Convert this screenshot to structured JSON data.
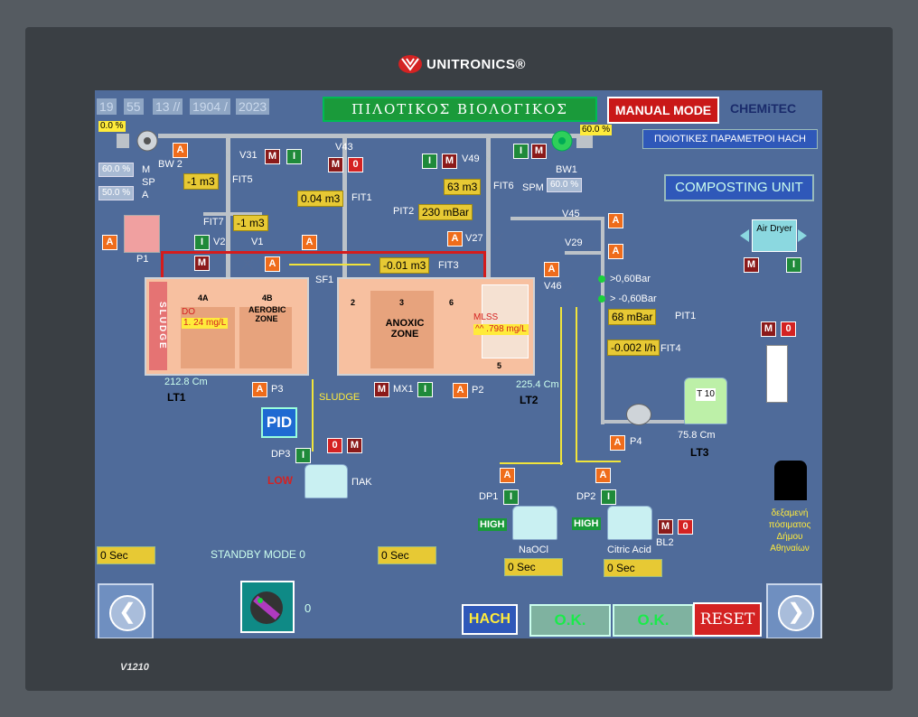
{
  "brand": {
    "name": "UNITRONICS®",
    "model": "V1210"
  },
  "clock": {
    "hour": "19",
    "minute": "55",
    "day": "13 //",
    "year_code": "1904 /",
    "year": "2023"
  },
  "title": "ΠΙΛΟΤΙΚΟΣ  ΒΙΟΛΟΓΙΚΟΣ",
  "mode_label": "MANUAL MODE",
  "chemitec_logo": "CHEMiTEC",
  "hach_params_label": "ΠΟΙΟΤΙΚΕΣ ΠΑΡΑΜΕΤΡΟΙ HACH",
  "composting_label": "COMPOSTING UNIT",
  "bw2": {
    "label": "BW 2",
    "percent": "0.0 %",
    "m_val": "60.0 %",
    "sp_val": "50.0 %",
    "m_lbl": "M",
    "sp_lbl": "SP",
    "a_lbl": "A"
  },
  "bw1": {
    "label": "BW1",
    "percent": "60.0 %",
    "spm_label": "SPM",
    "spm_val": "60.0 %"
  },
  "valves": {
    "v31": "V31",
    "v43": "V43",
    "v49": "V49",
    "v45": "V45",
    "v29": "V29",
    "v46": "V46",
    "v27": "V27",
    "v2": "V2",
    "v1": "V1"
  },
  "flows": {
    "fit5_val": "-1 m3",
    "fit5": "FIT5",
    "fit1_val": "0.04 m3",
    "fit1": "FIT1",
    "fit6_val": "63 m3",
    "fit6": "FIT6",
    "fit7": "FIT7",
    "fit7_val": "-1 m3",
    "pit2": "PIT2",
    "pit2_val": "230 mBar",
    "fit3_val": "-0.01 m3",
    "fit3": "FIT3",
    "pit1_val": "68 mBar",
    "pit1": "PIT1",
    "fit4_val": "-0.002 l/h",
    "fit4": "FIT4"
  },
  "pressure_switches": {
    "high": ">0,60Bar",
    "low": "> -0,60Bar"
  },
  "tanks": {
    "sludge": "SLUDGE",
    "t4a": "4A",
    "t4b": "4B",
    "aerobic": "AEROBIC ZONE",
    "t2": "2",
    "t3": "3",
    "anoxic": "ANOXIC ZONE",
    "t6": "6",
    "t5": "5",
    "do_label": "DO",
    "do_val": "1.  24 mg/L",
    "mlss_label": "MLSS",
    "mlss_val": "^^ .798 mg/L",
    "lt1_level": "212.8 Cm",
    "lt1": "LT1",
    "lt2_level": "225.4 Cm",
    "lt2": "LT2",
    "lt3_level": "75.8 Cm",
    "lt3": "LT3",
    "t10": "T 10",
    "sf1": "SF1",
    "p1": "P1",
    "p2": "P2",
    "p3": "P3",
    "p4": "P4",
    "mx1": "MX1",
    "a_marker": "A"
  },
  "air_dryer": "Air Dryer",
  "sludge_label": "SLUDGE",
  "dosing": {
    "dp3": "DP3",
    "pak": "ΠΑΚ",
    "low": "LOW",
    "dp1": "DP1",
    "naocl": "NaOCl",
    "high1": "HIGH",
    "dp2": "DP2",
    "citric": "Citric Acid",
    "high2": "HIGH",
    "bl2": "BL2"
  },
  "drinking_water": "δεξαμενή πόσιματος Δήμου Αθηναίων",
  "standby": "STANDBY MODE  0",
  "timers": {
    "t1": "0 Sec",
    "t2": "0 Sec",
    "t3": "0 Sec",
    "t4": "0 Sec"
  },
  "counter": "0",
  "buttons": {
    "pid": "PID",
    "hach": "HACH",
    "ok1": "O.K.",
    "ok2": "O.K.",
    "reset": "RESET",
    "a": "A",
    "m": "M",
    "i": "I",
    "zero": "0"
  },
  "colors": {
    "screen_bg": "#4f6b9a",
    "value_yellow": "#e7c934",
    "alarm_red": "#c91818",
    "ok_green": "#1aeb4a"
  }
}
